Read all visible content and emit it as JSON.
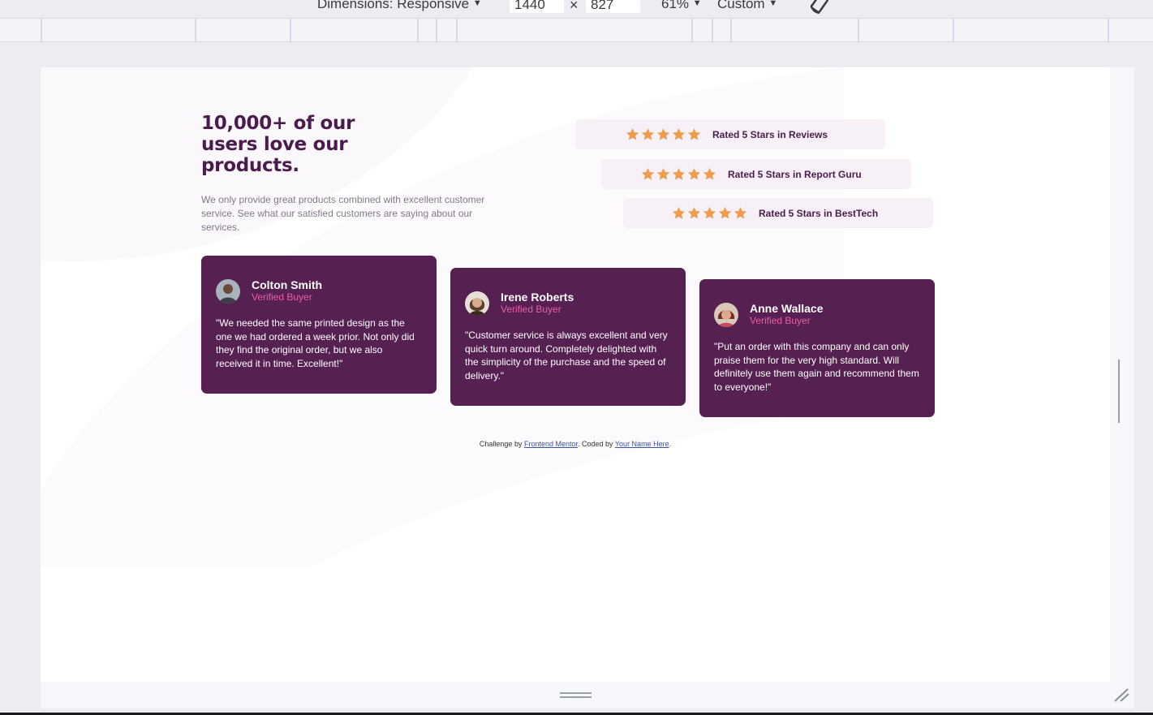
{
  "devtools": {
    "dimensions_label": "Dimensions: Responsive",
    "width_value": "1440",
    "times": "×",
    "height_value": "827",
    "zoom": "61%",
    "throttle": "Custom",
    "caret": "▼"
  },
  "hero": {
    "title": "10,000+ of our users love our products.",
    "description": "We only provide great products combined with excellent customer service. See what our satisfied customers are saying about our services."
  },
  "ratings": [
    {
      "label": "Rated 5 Stars in Reviews",
      "stars": 5
    },
    {
      "label": "Rated 5 Stars in Report Guru",
      "stars": 5
    },
    {
      "label": "Rated 5 Stars in BestTech",
      "stars": 5
    }
  ],
  "testimonials": [
    {
      "name": "Colton Smith",
      "role": "Verified Buyer",
      "quote": "\"We needed the same printed design as the one we had ordered a week prior. Not only did they find the original order, but we also received it in time. Excellent!\""
    },
    {
      "name": "Irene Roberts",
      "role": "Verified Buyer",
      "quote": "\"Customer service is always excellent and very quick turn around. Completely delighted with the simplicity of the purchase and the speed of delivery.\""
    },
    {
      "name": "Anne Wallace",
      "role": "Verified Buyer",
      "quote": "\"Put an order with this company and can only praise them for the very high standard. Will definitely use them again and recommend them to everyone!\""
    }
  ],
  "attribution": {
    "prefix": "Challenge by ",
    "link1": "Frontend Mentor",
    "middle": ". Coded by ",
    "link2": "Your Name Here",
    "suffix": "."
  },
  "colors": {
    "primary": "#4b1b4d",
    "card": "#562050",
    "accent": "#ea5ea8",
    "star": "#ee9c4d",
    "rating_bg": "#f7f1f7"
  }
}
